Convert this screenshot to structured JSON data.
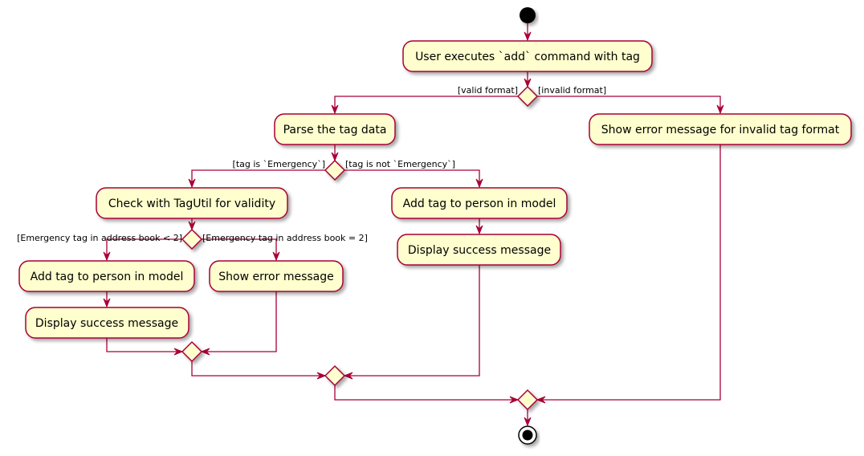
{
  "diagram": {
    "type": "activity",
    "colors": {
      "node_fill": "#FEFECE",
      "node_border": "#A80036",
      "edge": "#A80036",
      "start": "#000000"
    },
    "start": {
      "id": "start"
    },
    "actions": [
      {
        "id": "a1",
        "label": "User executes `add` command with tag"
      },
      {
        "id": "a2",
        "label": "Parse the tag data"
      },
      {
        "id": "a3",
        "label": "Show error message for invalid tag format"
      },
      {
        "id": "a4",
        "label": "Check with TagUtil for validity"
      },
      {
        "id": "a5",
        "label": "Add tag to person in model"
      },
      {
        "id": "a6",
        "label": "Display success message"
      },
      {
        "id": "a7",
        "label": "Add tag to person in model"
      },
      {
        "id": "a8",
        "label": "Show error message"
      },
      {
        "id": "a9",
        "label": "Display success message"
      }
    ],
    "decisions": [
      {
        "id": "d1",
        "left_guard": "[valid format]",
        "right_guard": "[invalid format]"
      },
      {
        "id": "d2",
        "left_guard": "[tag is `Emergency`]",
        "right_guard": "[tag is not `Emergency`]"
      },
      {
        "id": "d3",
        "left_guard": "[Emergency tag in address book < 2]",
        "right_guard": "[Emergency tag in address book = 2]"
      }
    ],
    "merges": [
      {
        "id": "m1"
      },
      {
        "id": "m2"
      },
      {
        "id": "m3"
      }
    ],
    "end": {
      "id": "end"
    },
    "flows": [
      [
        "start",
        "a1"
      ],
      [
        "a1",
        "d1"
      ],
      [
        "d1",
        "a2",
        "[valid format]"
      ],
      [
        "d1",
        "a3",
        "[invalid format]"
      ],
      [
        "a2",
        "d2"
      ],
      [
        "d2",
        "a4",
        "[tag is `Emergency`]"
      ],
      [
        "d2",
        "a5",
        "[tag is not `Emergency`]"
      ],
      [
        "a5",
        "a6"
      ],
      [
        "a4",
        "d3"
      ],
      [
        "d3",
        "a7",
        "[Emergency tag in address book < 2]"
      ],
      [
        "d3",
        "a8",
        "[Emergency tag in address book = 2]"
      ],
      [
        "a7",
        "a9"
      ],
      [
        "a9",
        "m1"
      ],
      [
        "a8",
        "m1"
      ],
      [
        "m1",
        "m2"
      ],
      [
        "a6",
        "m2"
      ],
      [
        "m2",
        "m3"
      ],
      [
        "a3",
        "m3"
      ],
      [
        "m3",
        "end"
      ]
    ]
  }
}
